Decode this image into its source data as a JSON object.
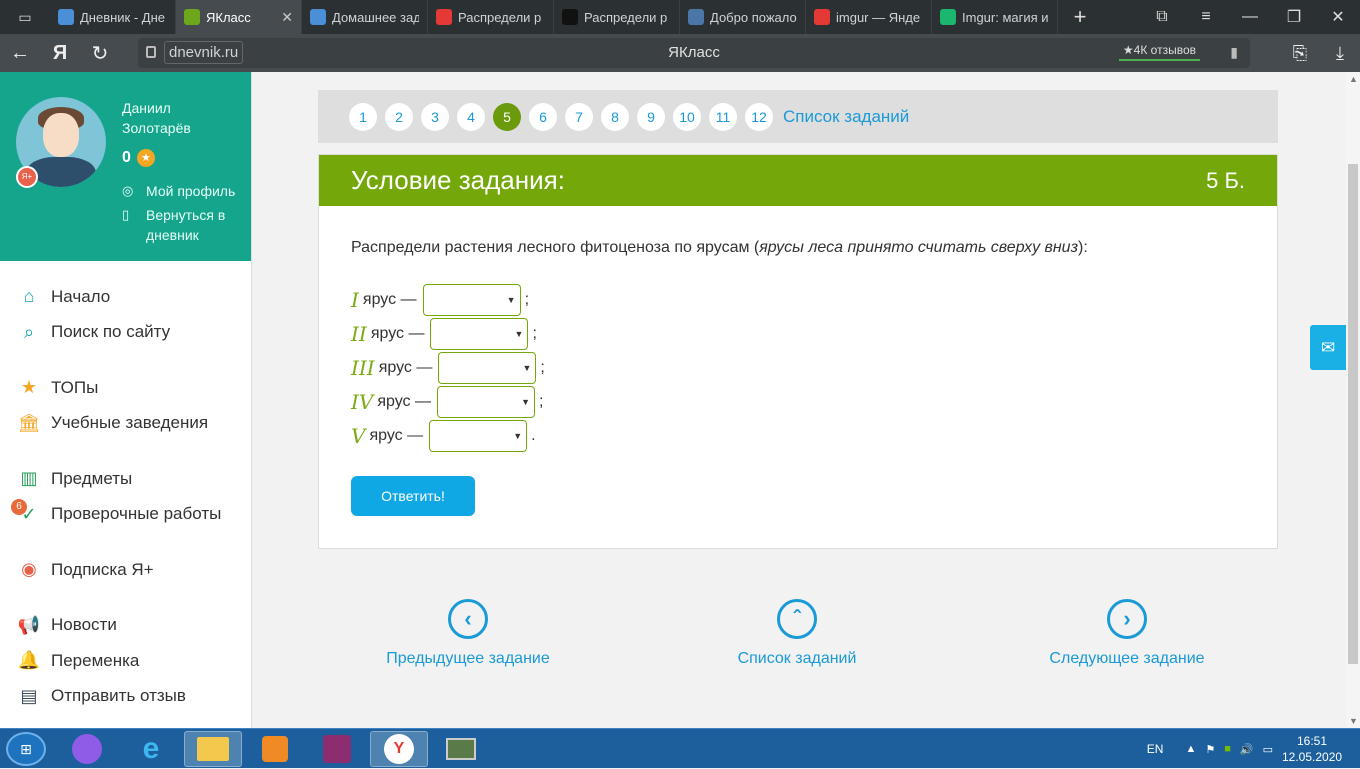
{
  "browser": {
    "tabs": [
      {
        "title": "Дневник - Дне",
        "icon": "dnevnik-icon",
        "color": "#4a8fd8"
      },
      {
        "title": "ЯКласс",
        "icon": "yaklass-icon",
        "color": "#6ca71e"
      },
      {
        "title": "Домашнее зад",
        "icon": "dnevnik-icon",
        "color": "#4a8fd8"
      },
      {
        "title": "Распредели р",
        "icon": "yandex-icon",
        "color": "#e53935"
      },
      {
        "title": "Распредели р",
        "icon": "znanija-icon",
        "color": "#111111"
      },
      {
        "title": "Добро пожало",
        "icon": "vk-icon",
        "color": "#4a76a8"
      },
      {
        "title": "imgur — Янде",
        "icon": "yandex-icon",
        "color": "#e53935"
      },
      {
        "title": "Imgur: магия и",
        "icon": "imgur-icon",
        "color": "#1bb76e"
      }
    ],
    "active_tab_index": 1,
    "domain": "dnevnik.ru",
    "page_title": "ЯКласс",
    "reviews": "★4К отзывов"
  },
  "profile": {
    "first_name": "Даниил",
    "last_name": "Золотарёв",
    "score": "0",
    "my_profile": "Мой профиль",
    "back_line1": "Вернуться в",
    "back_line2": "дневник",
    "avatar_badge": "Я+"
  },
  "menu": {
    "home": "Начало",
    "search": "Поиск по сайту",
    "tops": "ТОПы",
    "schools": "Учебные заведения",
    "subjects": "Предметы",
    "tests": "Проверочные работы",
    "tests_badge": "6",
    "subscription": "Подписка Я+",
    "news": "Новости",
    "break": "Переменка",
    "feedback": "Отправить отзыв"
  },
  "pager": {
    "pages": [
      "1",
      "2",
      "3",
      "4",
      "5",
      "6",
      "7",
      "8",
      "9",
      "10",
      "11",
      "12"
    ],
    "current": "5",
    "task_list": "Список заданий"
  },
  "task": {
    "header": "Условие задания:",
    "points": "5 Б.",
    "question_prefix": "Распредели растения лесного фитоценоза по ярусам (",
    "question_italic": "ярусы леса принято считать сверху вниз",
    "question_suffix": "):",
    "rows": [
      {
        "roman": "I",
        "label": "ярус —",
        "end": ";",
        "value": ""
      },
      {
        "roman": "II",
        "label": "ярус —",
        "end": ";",
        "value": ""
      },
      {
        "roman": "III",
        "label": "ярус —",
        "end": ";",
        "value": ""
      },
      {
        "roman": "IV",
        "label": "ярус —",
        "end": ";",
        "value": ""
      },
      {
        "roman": "V",
        "label": "ярус —",
        "end": ".",
        "value": ""
      }
    ],
    "submit": "Ответить!"
  },
  "navigation": {
    "prev": "Предыдущее задание",
    "list": "Список заданий",
    "next": "Следующее задание"
  },
  "taskbar": {
    "lang": "EN",
    "time": "16:51",
    "date": "12.05.2020"
  }
}
